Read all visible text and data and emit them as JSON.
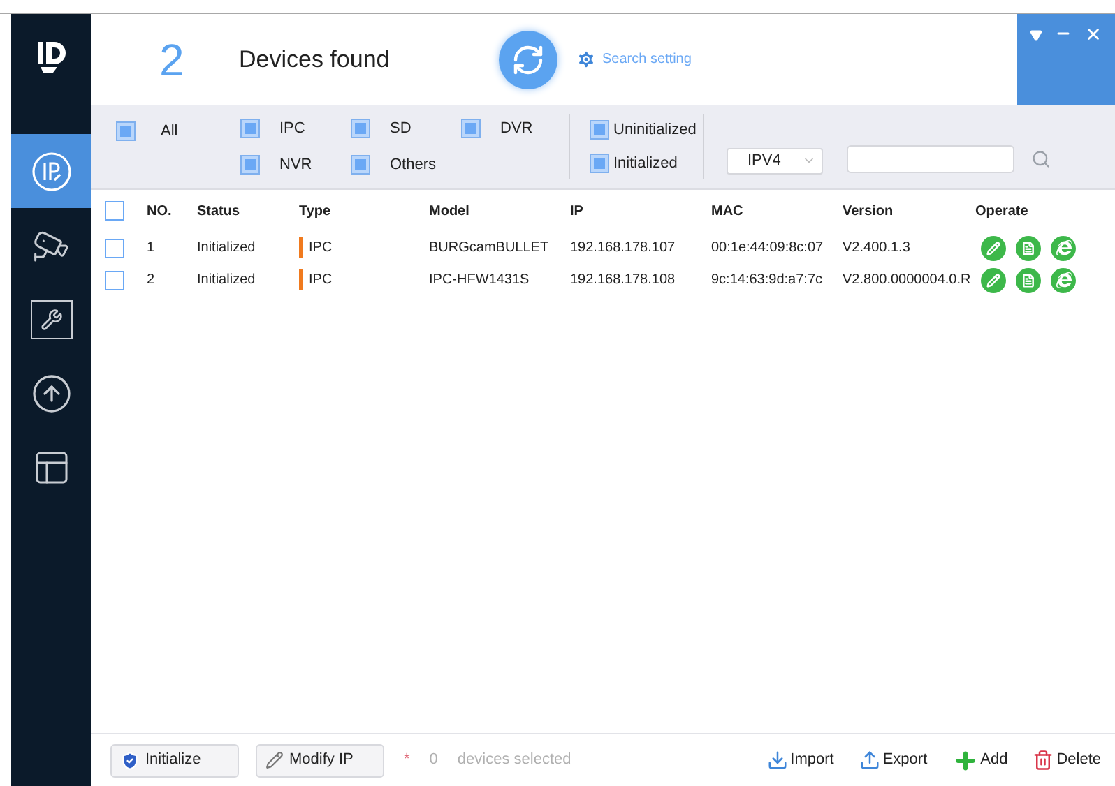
{
  "sidebar": {
    "items": [
      {
        "kind": "ip",
        "selected": true
      },
      {
        "kind": "camera",
        "selected": false
      },
      {
        "kind": "tools",
        "selected": false
      },
      {
        "kind": "upgrade",
        "selected": false
      },
      {
        "kind": "windows",
        "selected": false
      }
    ]
  },
  "header": {
    "count": "2",
    "title": "Devices found",
    "search_setting": "Search setting"
  },
  "filters": {
    "all": {
      "label": "All",
      "checked": true
    },
    "types": [
      {
        "label": "IPC",
        "checked": true
      },
      {
        "label": "SD",
        "checked": true
      },
      {
        "label": "DVR",
        "checked": true
      },
      {
        "label": "NVR",
        "checked": true
      },
      {
        "label": "Others",
        "checked": true
      }
    ],
    "statuses": [
      {
        "label": "Uninitialized",
        "checked": true
      },
      {
        "label": "Initialized",
        "checked": true
      }
    ],
    "protocol": "IPV4"
  },
  "table": {
    "select_all": {
      "checked": false
    },
    "columns": [
      "NO.",
      "Status",
      "Type",
      "Model",
      "IP",
      "MAC",
      "Version",
      "Operate"
    ],
    "rows": [
      {
        "checked": false,
        "cells": [
          "1",
          "Initialized",
          "IPC",
          "BURGcamBULLET",
          "192.168.178.107",
          "00:1e:44:09:8c:07",
          "V2.400.1.3"
        ]
      },
      {
        "checked": false,
        "cells": [
          "2",
          "Initialized",
          "IPC",
          "IPC-HFW1431S",
          "192.168.178.108",
          "9c:14:63:9d:a7:7c",
          "V2.800.0000004.0.R"
        ]
      }
    ]
  },
  "footer": {
    "buttons_left": [
      "Initialize",
      "Modify IP"
    ],
    "required_mark": "*",
    "selected_count": "0",
    "selected_label": "devices selected",
    "buttons_right": [
      {
        "kind": "import",
        "label": "Import"
      },
      {
        "kind": "export",
        "label": "Export"
      },
      {
        "kind": "add",
        "label": "Add"
      },
      {
        "kind": "delete",
        "label": "Delete"
      }
    ]
  }
}
